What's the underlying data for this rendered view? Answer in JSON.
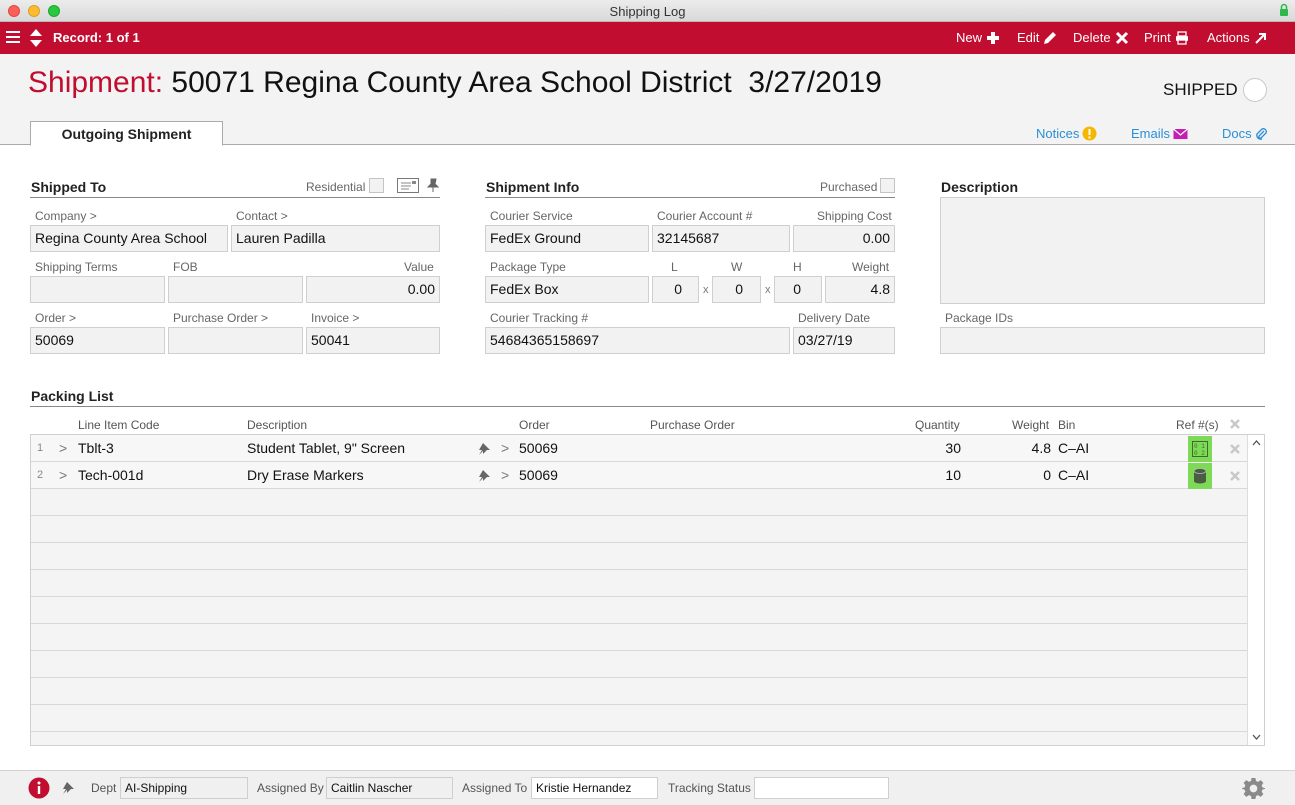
{
  "window": {
    "title": "Shipping Log"
  },
  "toolbar": {
    "record_label": "Record: 1 of 1",
    "new_label": "New",
    "edit_label": "Edit",
    "delete_label": "Delete",
    "print_label": "Print",
    "actions_label": "Actions"
  },
  "header": {
    "title_label": "Shipment:",
    "title_value": "50071 Regina County Area School District  3/27/2019",
    "status_label": "SHIPPED"
  },
  "tabs": {
    "active": "Outgoing Shipment"
  },
  "links": {
    "notices": "Notices",
    "emails": "Emails",
    "docs": "Docs"
  },
  "shipped_to": {
    "title": "Shipped To",
    "residential_label": "Residential",
    "company_label": "Company >",
    "company": "Regina County Area School",
    "contact_label": "Contact >",
    "contact": "Lauren Padilla",
    "shipping_terms_label": "Shipping Terms",
    "shipping_terms": "",
    "fob_label": "FOB",
    "fob": "",
    "value_label": "Value",
    "value": "0.00",
    "order_label": "Order >",
    "order": "50069",
    "purchase_order_label": "Purchase Order >",
    "purchase_order": "",
    "invoice_label": "Invoice >",
    "invoice": "50041"
  },
  "shipment_info": {
    "title": "Shipment Info",
    "purchased_label": "Purchased",
    "courier_service_label": "Courier Service",
    "courier_service": "FedEx Ground",
    "courier_account_label": "Courier Account #",
    "courier_account": "32145687",
    "shipping_cost_label": "Shipping Cost",
    "shipping_cost": "0.00",
    "package_type_label": "Package Type",
    "package_type": "FedEx Box",
    "l_label": "L",
    "l": "0",
    "w_label": "W",
    "w": "0",
    "h_label": "H",
    "h": "0",
    "x_sep": "x",
    "weight_label": "Weight",
    "weight": "4.8",
    "tracking_label": "Courier Tracking #",
    "tracking": "54684365158697",
    "delivery_date_label": "Delivery Date",
    "delivery_date": "03/27/19"
  },
  "description": {
    "title": "Description",
    "text": "",
    "package_ids_label": "Package IDs",
    "package_ids": ""
  },
  "packing_list": {
    "title": "Packing List",
    "columns": {
      "line_item_code": "Line Item Code",
      "description": "Description",
      "order": "Order",
      "purchase_order": "Purchase Order",
      "quantity": "Quantity",
      "weight": "Weight",
      "bin": "Bin",
      "ref": "Ref #(s)"
    },
    "rows": [
      {
        "num": "1",
        "code": "Tblt-3",
        "description": "Student Tablet, 9\" Screen",
        "order": "50069",
        "purchase_order": "",
        "quantity": "30",
        "weight": "4.8",
        "bin": "C–AI"
      },
      {
        "num": "2",
        "code": "Tech-001d",
        "description": "Dry Erase Markers",
        "order": "50069",
        "purchase_order": "",
        "quantity": "10",
        "weight": "0",
        "bin": "C–AI"
      }
    ],
    "arrow": ">"
  },
  "footer": {
    "dept_label": "Dept",
    "dept": "AI-Shipping",
    "assigned_by_label": "Assigned By",
    "assigned_by": "Caitlin Nascher",
    "assigned_to_label": "Assigned To",
    "assigned_to": "Kristie Hernandez",
    "tracking_status_label": "Tracking Status",
    "tracking_status": ""
  },
  "colors": {
    "accent": "#c10d2f",
    "link": "#2a8fd6",
    "ref_green": "#7ed957",
    "notice": "#f5b800",
    "email": "#c41fb0"
  }
}
